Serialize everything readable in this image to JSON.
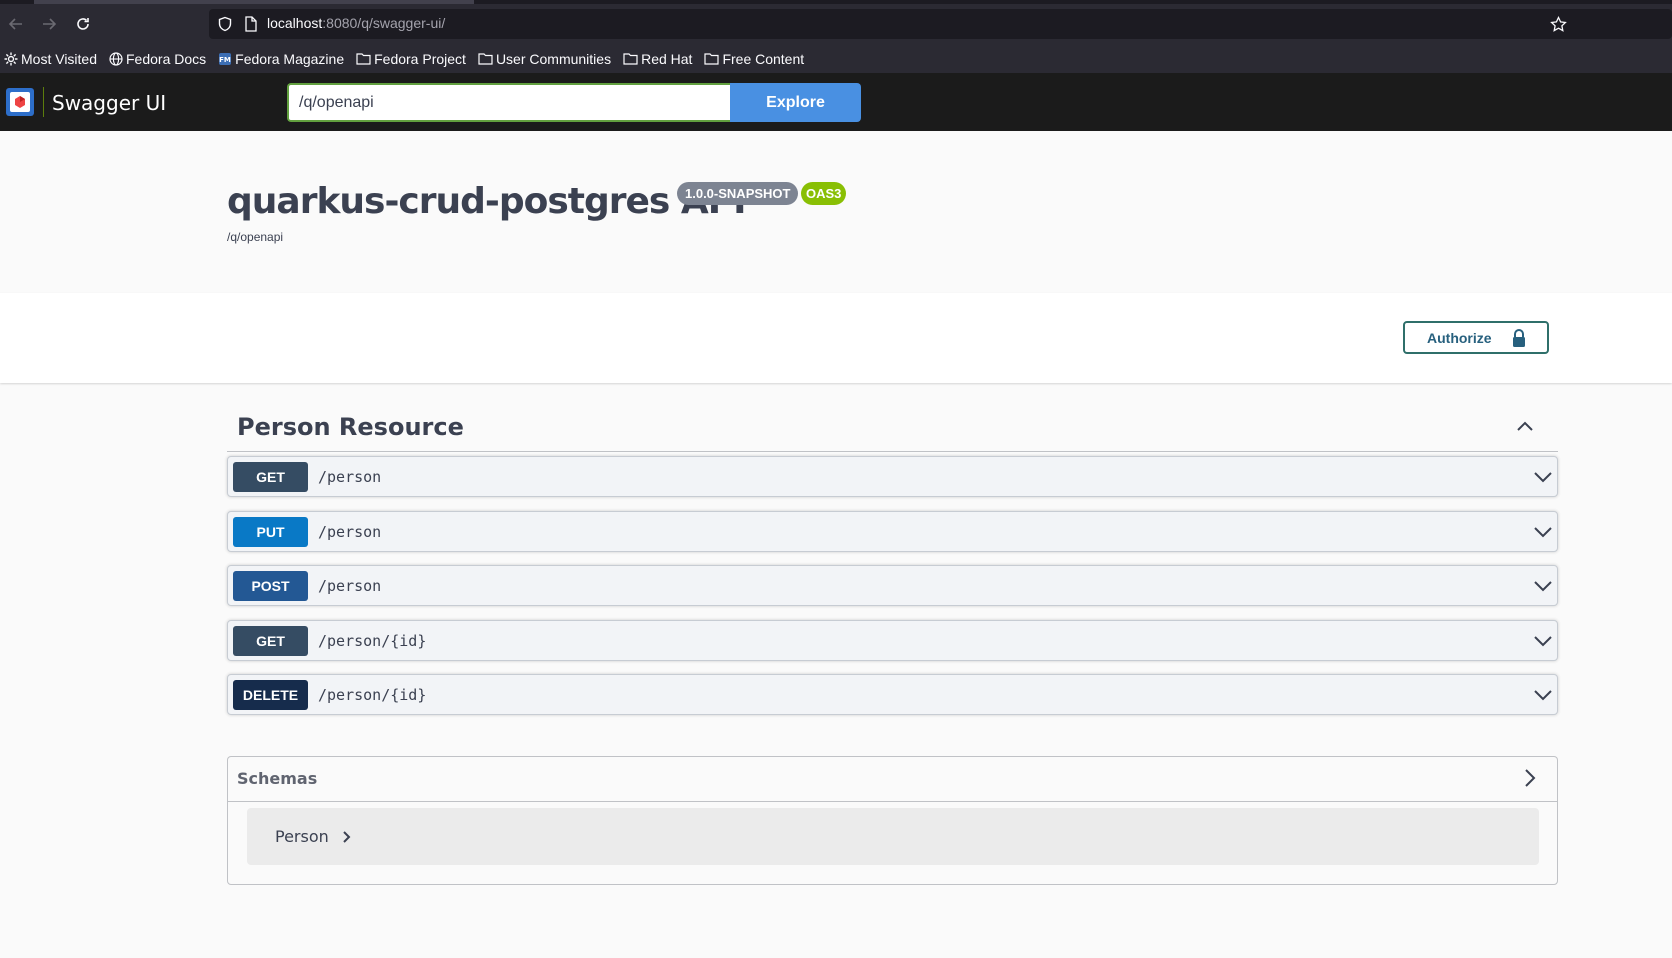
{
  "browser": {
    "url_host": "localhost",
    "url_rest": ":8080/q/swagger-ui/",
    "bookmarks": [
      {
        "label": "Most Visited",
        "icon": "gear-icon"
      },
      {
        "label": "Fedora Docs",
        "icon": "globe-icon"
      },
      {
        "label": "Fedora Magazine",
        "icon": "fm-icon"
      },
      {
        "label": "Fedora Project",
        "icon": "folder-icon"
      },
      {
        "label": "User Communities",
        "icon": "folder-icon"
      },
      {
        "label": "Red Hat",
        "icon": "folder-icon"
      },
      {
        "label": "Free Content",
        "icon": "folder-icon"
      }
    ]
  },
  "topbar": {
    "brand": "Swagger UI",
    "spec_url": "/q/openapi",
    "explore_label": "Explore"
  },
  "info": {
    "title": "quarkus-crud-postgres API",
    "version": "1.0.0-SNAPSHOT",
    "oas": "OAS3",
    "url": "/q/openapi"
  },
  "scheme": {
    "authorize_label": "Authorize"
  },
  "tag": {
    "name": "Person Resource"
  },
  "operations": [
    {
      "method": "GET",
      "path": "/person",
      "color": "#354c63"
    },
    {
      "method": "PUT",
      "path": "/person",
      "color": "#0979c6"
    },
    {
      "method": "POST",
      "path": "/person",
      "color": "#235894"
    },
    {
      "method": "GET",
      "path": "/person/{id}",
      "color": "#354c63"
    },
    {
      "method": "DELETE",
      "path": "/person/{id}",
      "color": "#162c4c"
    }
  ],
  "schemas": {
    "title": "Schemas",
    "models": [
      {
        "name": "Person"
      }
    ]
  },
  "colors": {
    "topbar_bg": "#1b1b1b",
    "explore_btn": "#4990e2",
    "version_badge": "#7d8492",
    "oas_badge": "#89bf04"
  }
}
